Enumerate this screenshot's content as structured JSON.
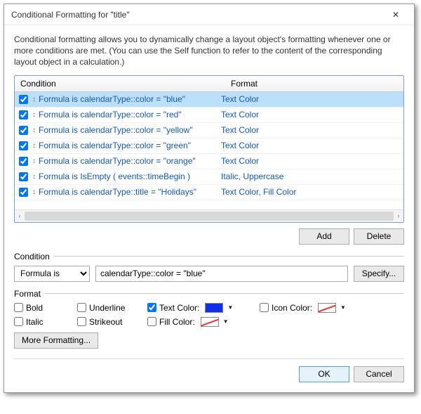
{
  "window": {
    "title": "Conditional Formatting for \"title\""
  },
  "intro": "Conditional formatting allows you to dynamically change a layout object's formatting whenever one or more conditions are met. (You can use the Self function to refer to the content of the corresponding layout object in a calculation.)",
  "columns": {
    "condition": "Condition",
    "format": "Format"
  },
  "rows": [
    {
      "checked": true,
      "condition": "Formula is calendarType::color = \"blue\"",
      "format": "Text Color",
      "selected": true
    },
    {
      "checked": true,
      "condition": "Formula is calendarType::color = \"red\"",
      "format": "Text Color"
    },
    {
      "checked": true,
      "condition": "Formula is calendarType::color = \"yellow\"",
      "format": "Text Color"
    },
    {
      "checked": true,
      "condition": "Formula is calendarType::color = \"green\"",
      "format": "Text Color"
    },
    {
      "checked": true,
      "condition": "Formula is calendarType::color = \"orange\"",
      "format": "Text Color"
    },
    {
      "checked": true,
      "condition": "Formula is IsEmpty ( events::timeBegin )",
      "format": "Italic, Uppercase"
    },
    {
      "checked": true,
      "condition": "Formula is calendarType::title = \"Holidays\"",
      "format": "Text Color, Fill Color"
    }
  ],
  "buttons": {
    "add": "Add",
    "delete": "Delete",
    "specify": "Specify...",
    "more": "More Formatting...",
    "ok": "OK",
    "cancel": "Cancel"
  },
  "sections": {
    "condition": "Condition",
    "format": "Format"
  },
  "condition_editor": {
    "type": "Formula is",
    "value": "calendarType::color = \"blue\""
  },
  "format_options": {
    "bold": {
      "label": "Bold",
      "checked": false
    },
    "italic": {
      "label": "Italic",
      "checked": false
    },
    "underline": {
      "label": "Underline",
      "checked": false
    },
    "strikeout": {
      "label": "Strikeout",
      "checked": false
    },
    "text_color": {
      "label": "Text Color:",
      "checked": true,
      "color": "#1030e8"
    },
    "fill_color": {
      "label": "Fill Color:",
      "checked": false,
      "color": null
    },
    "icon_color": {
      "label": "Icon Color:",
      "checked": false,
      "color": null
    }
  }
}
